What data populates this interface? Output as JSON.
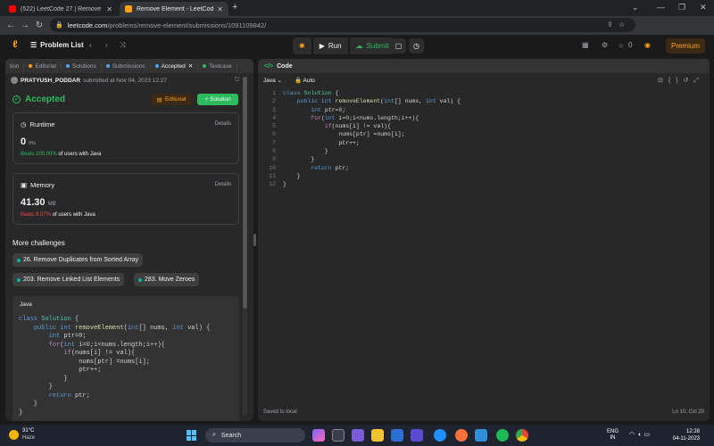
{
  "browser": {
    "tabs": [
      {
        "title": "(522) LeetCode 27 | Remove Ele",
        "active": false
      },
      {
        "title": "Remove Element - LeetCode",
        "active": true
      }
    ],
    "new_tab": "+",
    "url_host": "leetcode.com",
    "url_path": "/problems/remove-element/submissions/1091109842/"
  },
  "navbar": {
    "problem_list": "Problem List",
    "run": "Run",
    "submit": "Submit",
    "streak": "0",
    "premium": "Premium"
  },
  "left_tabs": [
    {
      "label": "tion"
    },
    {
      "label": "Editorial"
    },
    {
      "label": "Solutions"
    },
    {
      "label": "Submissions"
    },
    {
      "label": "Accepted"
    },
    {
      "label": "Testcase"
    }
  ],
  "submission": {
    "user": "PRATYUSH_PODDAR",
    "meta": "submitted at Nov 04, 2023 12:27",
    "status": "Accepted",
    "editorial_btn": "Editorial",
    "solution_btn": "Solution"
  },
  "runtime": {
    "title": "Runtime",
    "details": "Details",
    "value": "0",
    "unit": "ms",
    "beats": "Beats 100.00%",
    "beats_suffix": "of users with Java"
  },
  "memory": {
    "title": "Memory",
    "details": "Details",
    "value": "41.30",
    "unit": "MB",
    "beats": "Beats 8.07%",
    "beats_suffix": "of users with Java"
  },
  "more": {
    "title": "More challenges",
    "items": [
      "26. Remove Duplicates from Sorted Array",
      "203. Remove Linked List Elements",
      "283. Move Zeroes"
    ]
  },
  "submitted_code": {
    "lang": "Java",
    "lines": [
      "class Solution {",
      "    public int removeElement(int[] nums, int val) {",
      "        int ptr=0;",
      "        for(int i=0;i<nums.length;i++){",
      "            if(nums[i] != val){",
      "                nums[ptr] =nums[i];",
      "                ptr++;",
      "            }",
      "        }",
      "        return ptr;",
      "    }",
      "}"
    ]
  },
  "editor": {
    "title": "Code",
    "lang": "Java",
    "mode": "Auto",
    "line_numbers": [
      "1",
      "2",
      "3",
      "4",
      "5",
      "6",
      "7",
      "8",
      "9",
      "10",
      "11",
      "12"
    ],
    "lines": [
      "class Solution {",
      "    public int removeElement(int[] nums, int val) {",
      "        int ptr=0;",
      "        for(int i=0;i<nums.length;i++){",
      "            if(nums[i] != val){",
      "                nums[ptr] =nums[i];",
      "                ptr++;",
      "            }",
      "        }",
      "        return ptr;",
      "    }",
      "}"
    ],
    "status_left": "Saved to local",
    "status_right": "Ln 10, Col 20"
  },
  "taskbar": {
    "temp": "31°C",
    "weather": "Haze",
    "search": "Search",
    "lang1": "ENG",
    "lang2": "IN",
    "time": "12:28",
    "date": "04-11-2023"
  },
  "colors": {
    "accent_green": "#2cbb5d",
    "accent_orange": "#ffa116",
    "beats_red": "#ef4743",
    "panel": "#282828"
  }
}
